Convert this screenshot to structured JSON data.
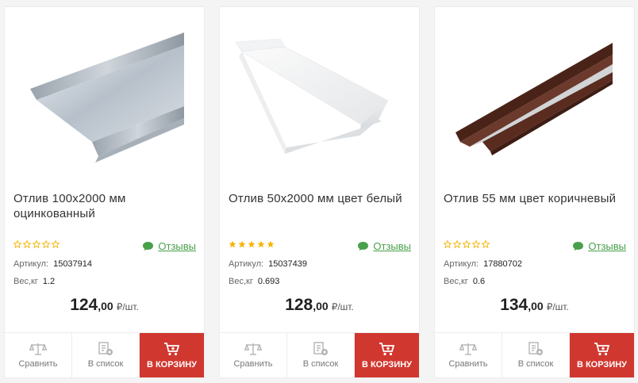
{
  "products": [
    {
      "title": "Отлив 100х2000 мм оцинкованный",
      "rating_filled": 0,
      "reviews_label": "Отзывы",
      "article_label": "Артикул:",
      "article": "15037914",
      "weight_label": "Вес,кг",
      "weight": "1.2",
      "price_main": "124",
      "price_cents": ",00",
      "price_unit": "₽/шт.",
      "compare_label": "Сравнить",
      "list_label": "В список",
      "cart_label": "В КОРЗИНУ",
      "image_icon": "galvanized-sill-image"
    },
    {
      "title": "Отлив 50х2000 мм цвет белый",
      "rating_filled": 5,
      "reviews_label": "Отзывы",
      "article_label": "Артикул:",
      "article": "15037439",
      "weight_label": "Вес,кг",
      "weight": "0.693",
      "price_main": "128",
      "price_cents": ",00",
      "price_unit": "₽/шт.",
      "compare_label": "Сравнить",
      "list_label": "В список",
      "cart_label": "В КОРЗИНУ",
      "image_icon": "white-sill-image"
    },
    {
      "title": "Отлив 55 мм цвет коричневый",
      "rating_filled": 0,
      "reviews_label": "Отзывы",
      "article_label": "Артикул:",
      "article": "17880702",
      "weight_label": "Вес,кг",
      "weight": "0.6",
      "price_main": "134",
      "price_cents": ",00",
      "price_unit": "₽/шт.",
      "compare_label": "Сравнить",
      "list_label": "В список",
      "cart_label": "В КОРЗИНУ",
      "image_icon": "brown-sill-image"
    }
  ],
  "colors": {
    "star_filled": "#f5b301",
    "star_empty": "#f5b301",
    "reviews": "#48a04a",
    "cart_bg": "#d0372f"
  }
}
